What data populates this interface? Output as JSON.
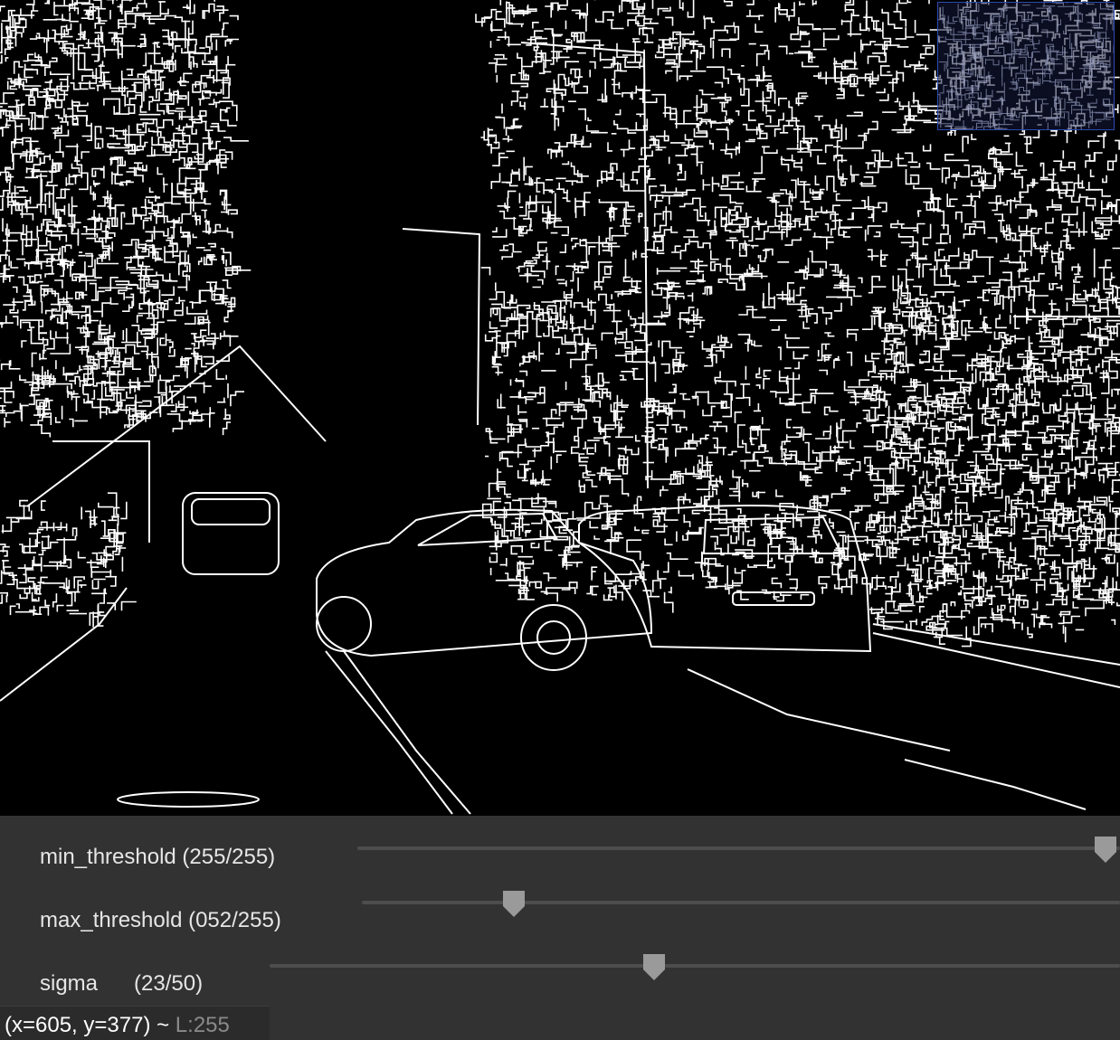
{
  "sliders": [
    {
      "label": "min_threshold (255/255)",
      "value": 255,
      "max": 255
    },
    {
      "label": "max_threshold (052/255)",
      "value": 52,
      "max": 255
    },
    {
      "label": "sigma      (23/50)",
      "value": 23,
      "max": 50
    }
  ],
  "status": {
    "coords": "(x=605, y=377) ~ ",
    "value_label": "L:255"
  },
  "colors": {
    "canvas": "#000000",
    "edges": "#ffffff",
    "panel": "#323232",
    "track": "#4d4d4d",
    "thumb": "#9a9a9a",
    "minimap_border": "#2d4bb0"
  }
}
